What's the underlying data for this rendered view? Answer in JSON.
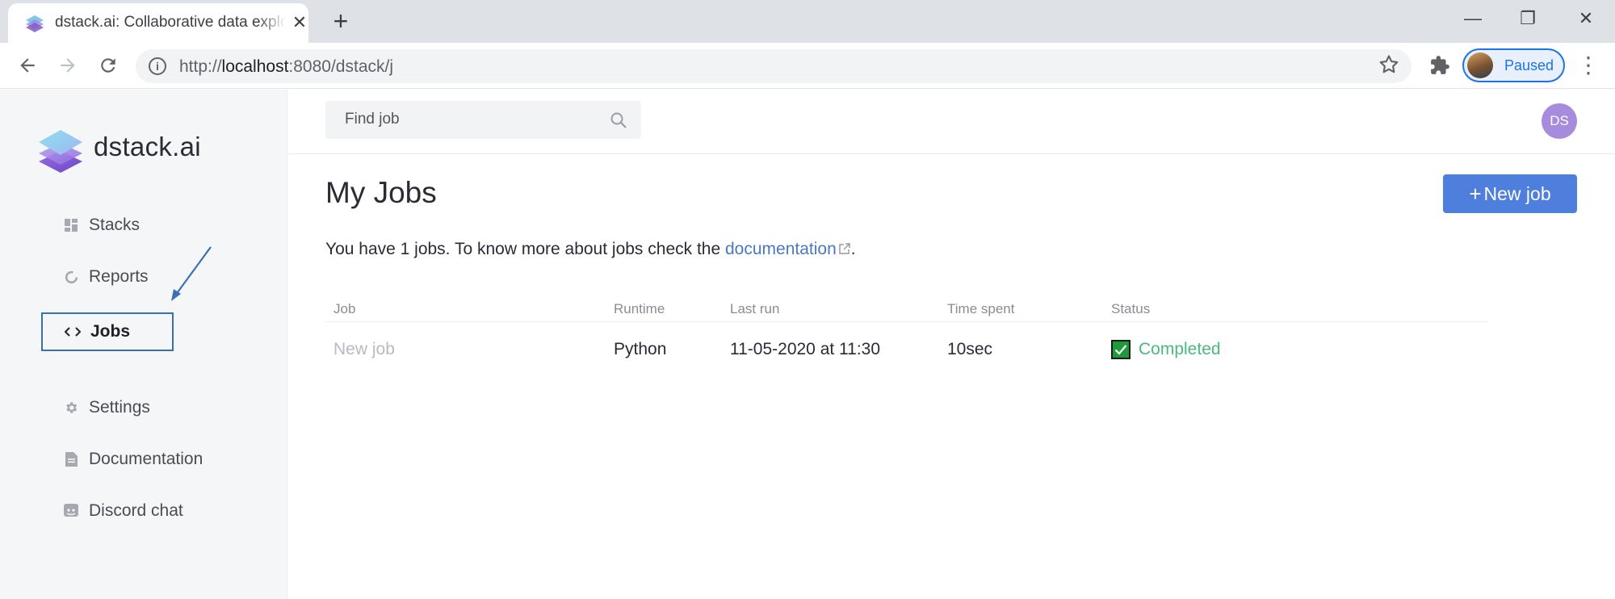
{
  "browser": {
    "tab_title": "dstack.ai: Collaborative data exploration",
    "tab_close": "✕",
    "new_tab": "+",
    "url_prefix": "http://",
    "url_host": "localhost",
    "url_path": ":8080/dstack/j",
    "profile_label": "Paused",
    "window_minimize": "—",
    "window_restore": "❐",
    "window_close": "✕"
  },
  "sidebar": {
    "brand": "dstack.ai",
    "items": [
      {
        "label": "Stacks",
        "icon": "dashboard-icon"
      },
      {
        "label": "Reports",
        "icon": "reports-icon"
      },
      {
        "label": "Jobs",
        "icon": "code-icon",
        "active": true
      },
      {
        "label": "Settings",
        "icon": "gear-icon"
      },
      {
        "label": "Documentation",
        "icon": "document-icon"
      },
      {
        "label": "Discord chat",
        "icon": "discord-icon"
      }
    ]
  },
  "header": {
    "search_placeholder": "Find job",
    "user_initials": "DS"
  },
  "main": {
    "title": "My Jobs",
    "new_job_label": "New job",
    "new_job_plus": "+",
    "intro_text": "You have 1 jobs. To know more about jobs check the ",
    "intro_link": "documentation",
    "intro_end": ".",
    "columns": [
      "Job",
      "Runtime",
      "Last run",
      "Time spent",
      "Status"
    ],
    "rows": [
      {
        "job": "New job",
        "runtime": "Python",
        "last_run": "11-05-2020 at 11:30",
        "time_spent": "10sec",
        "status": "Completed"
      }
    ]
  },
  "colors": {
    "accent": "#4f7fdc",
    "status_completed": "#4cb87f",
    "avatar": "#a78bdc",
    "annotation": "#3a6fb5"
  }
}
